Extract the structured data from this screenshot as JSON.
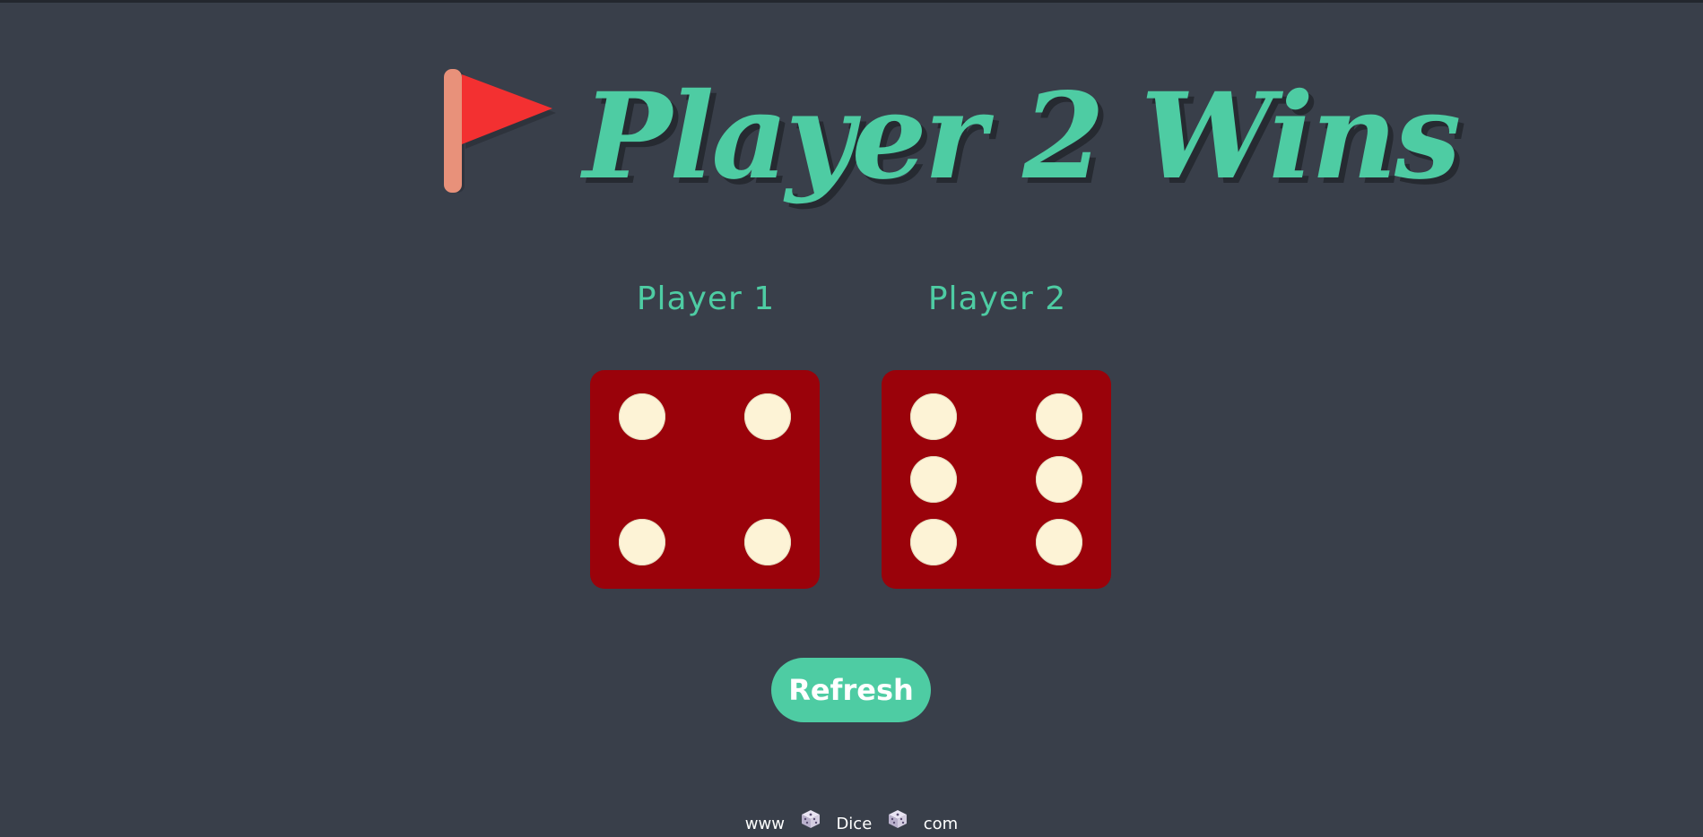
{
  "title": {
    "icon": "red-flag-icon",
    "text": "Player 2 Wins"
  },
  "players": [
    {
      "label": "Player 1",
      "die_value": 4
    },
    {
      "label": "Player 2",
      "die_value": 6
    }
  ],
  "refresh_button": {
    "label": "Refresh"
  },
  "footer": {
    "part1": "www",
    "icon": "dice-icon",
    "part2": "Dice",
    "part3": "com"
  },
  "colors": {
    "background": "#393f4a",
    "accent": "#4ecca3",
    "die": "#9a020a",
    "pip": "#fdf3d6",
    "flag": "#f33031"
  }
}
